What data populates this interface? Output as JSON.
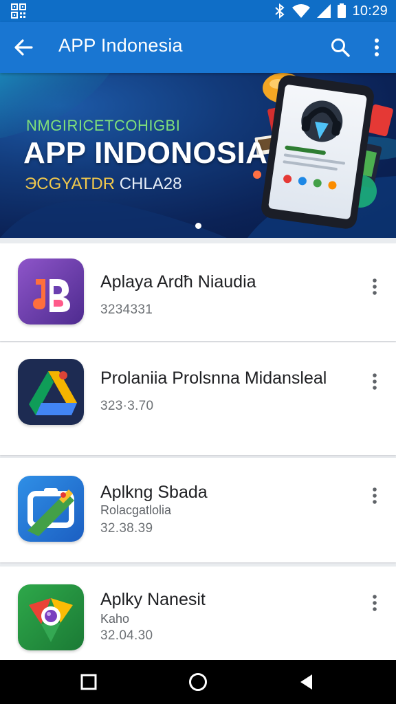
{
  "status_bar": {
    "time": "10:29",
    "icons": [
      "qr-code-icon",
      "bluetooth-icon",
      "wifi-icon",
      "signal-icon",
      "battery-icon"
    ]
  },
  "app_bar": {
    "title": "APP Indonesia",
    "icons": [
      "back-arrow-icon",
      "search-icon",
      "more-vert-icon"
    ]
  },
  "banner": {
    "kicker": "NMGIRICETCOHIGBI",
    "title": "APP INDONOSIA",
    "subtitle_a": "ЭCGYATDR",
    "subtitle_b": "CHLA28",
    "page_indicator": {
      "count": 1,
      "active": 1
    }
  },
  "apps": [
    {
      "title": "Aplaya Ardħ Niaudia",
      "subtitle": "",
      "meta": "3234331",
      "icon": "music-app-icon"
    },
    {
      "title": "Prolaniia Prolsnna Midansleal",
      "subtitle": "",
      "meta": "323·3.70",
      "icon": "drive-app-icon"
    },
    {
      "title": "Aplkng Sbada",
      "subtitle": "Rolacgatlolia",
      "meta": "32.38.39",
      "icon": "photo-app-icon"
    },
    {
      "title": "Aplky Nanesit",
      "subtitle": "Kaho",
      "meta": "32.04.30",
      "icon": "chrome-app-icon"
    }
  ],
  "nav_bar": {
    "icons": [
      "recents-square-icon",
      "home-circle-icon",
      "back-triangle-icon"
    ]
  },
  "colors": {
    "status_bar": "#0f6ec7",
    "app_bar": "#1976d2",
    "banner_bg": "#0b2256",
    "list_bg": "#e9ecef"
  }
}
